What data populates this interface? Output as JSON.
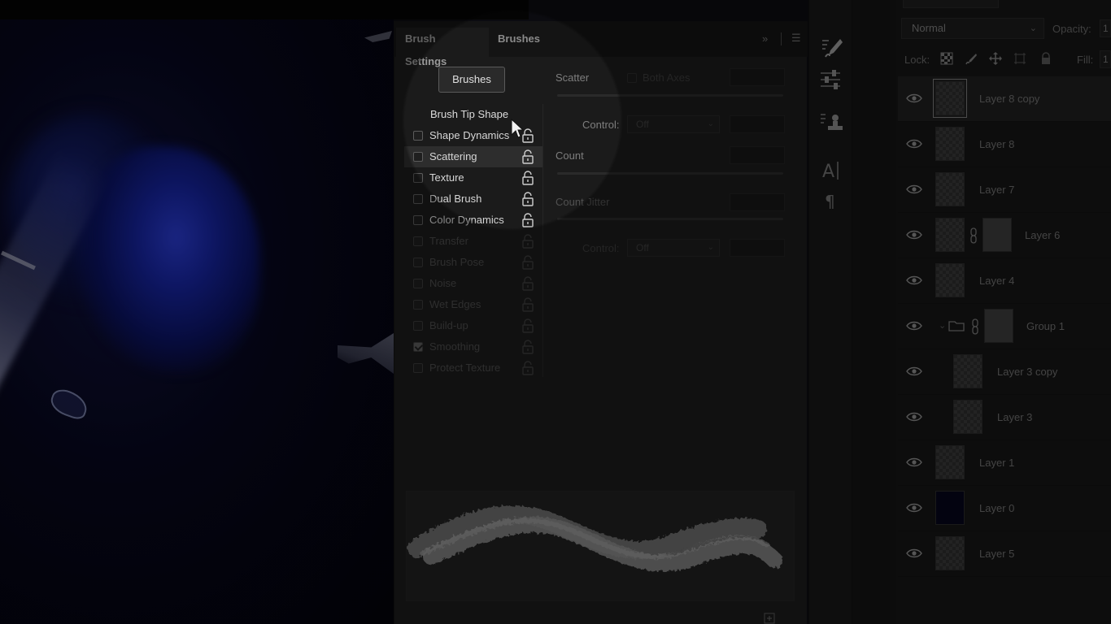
{
  "brush_panel": {
    "tabs": [
      {
        "label": "Brush Settings",
        "active": true
      },
      {
        "label": "Brushes",
        "active": false
      }
    ],
    "brushes_button": "Brushes",
    "options": [
      {
        "label": "Brush Tip Shape",
        "checkbox": false,
        "checked": false,
        "lock": false,
        "state": "bright"
      },
      {
        "label": "Shape Dynamics",
        "checkbox": true,
        "checked": false,
        "lock": true,
        "state": "bright"
      },
      {
        "label": "Scattering",
        "checkbox": true,
        "checked": false,
        "lock": true,
        "state": "bright",
        "active": true
      },
      {
        "label": "Texture",
        "checkbox": true,
        "checked": false,
        "lock": true,
        "state": "bright"
      },
      {
        "label": "Dual Brush",
        "checkbox": true,
        "checked": false,
        "lock": true,
        "state": "bright"
      },
      {
        "label": "Color Dynamics",
        "checkbox": true,
        "checked": false,
        "lock": true,
        "state": "bright"
      },
      {
        "label": "Transfer",
        "checkbox": true,
        "checked": false,
        "lock": true,
        "state": "dim"
      },
      {
        "label": "Brush Pose",
        "checkbox": true,
        "checked": false,
        "lock": true,
        "state": "dim"
      },
      {
        "label": "Noise",
        "checkbox": true,
        "checked": false,
        "lock": true,
        "state": "dim"
      },
      {
        "label": "Wet Edges",
        "checkbox": true,
        "checked": false,
        "lock": true,
        "state": "dim"
      },
      {
        "label": "Build-up",
        "checkbox": true,
        "checked": false,
        "lock": true,
        "state": "dim"
      },
      {
        "label": "Smoothing",
        "checkbox": true,
        "checked": true,
        "lock": true,
        "state": "dim"
      },
      {
        "label": "Protect Texture",
        "checkbox": true,
        "checked": false,
        "lock": true,
        "state": "dim"
      }
    ],
    "scatter": {
      "scatter_label": "Scatter",
      "both_axes_label": "Both Axes",
      "control_label": "Control:",
      "control_value": "Off",
      "count_label": "Count",
      "count_jitter_label": "Count Jitter",
      "control2_label": "Control:",
      "control2_value": "Off"
    }
  },
  "layers_panel": {
    "blend_mode": "Normal",
    "opacity_label": "Opacity:",
    "opacity_value": "1",
    "lock_label": "Lock:",
    "fill_label": "Fill:",
    "fill_value": "1",
    "layers": [
      {
        "name": "Layer 8 copy",
        "selected": true,
        "indent": 0,
        "thumb": "transparent"
      },
      {
        "name": "Layer 8",
        "selected": false,
        "indent": 0,
        "thumb": "transparent"
      },
      {
        "name": "Layer 7",
        "selected": false,
        "indent": 0,
        "thumb": "transparent"
      },
      {
        "name": "Layer 6",
        "selected": false,
        "indent": 0,
        "thumb": "transparent",
        "mask": true
      },
      {
        "name": "Layer 4",
        "selected": false,
        "indent": 0,
        "thumb": "transparent"
      },
      {
        "name": "Group 1",
        "selected": false,
        "indent": 0,
        "thumb": "mask",
        "group": true
      },
      {
        "name": "Layer 3 copy",
        "selected": false,
        "indent": 1,
        "thumb": "transparent"
      },
      {
        "name": "Layer 3",
        "selected": false,
        "indent": 1,
        "thumb": "transparent"
      },
      {
        "name": "Layer 1",
        "selected": false,
        "indent": 0,
        "thumb": "transparent"
      },
      {
        "name": "Layer 0",
        "selected": false,
        "indent": 0,
        "thumb": "dark"
      },
      {
        "name": "Layer 5",
        "selected": false,
        "indent": 0,
        "thumb": "transparent"
      }
    ]
  },
  "tool_strip": {
    "icons": [
      "brush-settings-icon",
      "adjustments-icon",
      "clone-source-icon",
      "character-icon",
      "paragraph-icon"
    ]
  },
  "colors": {
    "panel_bg": "#1b1b1b",
    "tab_bar": "#141414",
    "canvas_blue": "#1624a0"
  }
}
